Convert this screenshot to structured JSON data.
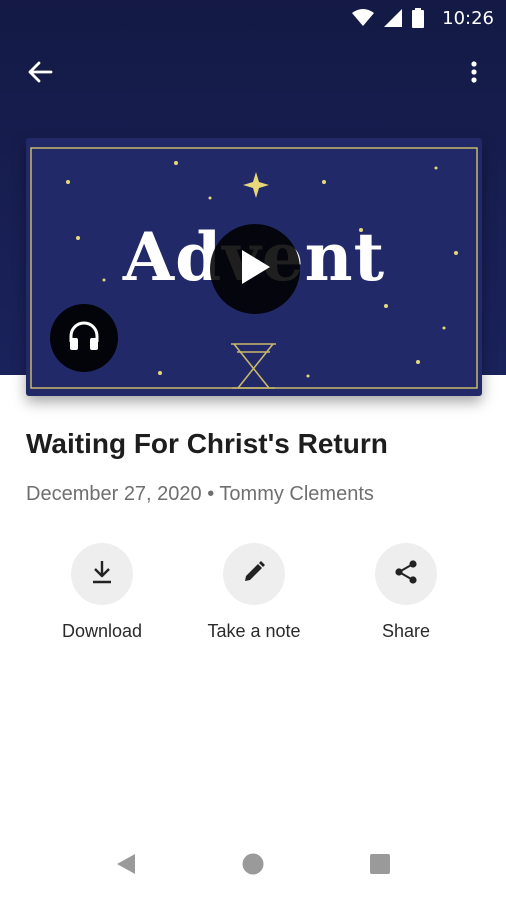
{
  "status_bar": {
    "time": "10:26"
  },
  "icons": {
    "back": "arrow-left-icon",
    "more": "more-vertical-icon",
    "play": "play-icon",
    "audio": "headphones-icon",
    "download": "download-icon",
    "note": "pencil-icon",
    "share": "share-icon"
  },
  "media": {
    "artwork_text": "Advent"
  },
  "sermon": {
    "title": "Waiting For Christ's Return",
    "meta": "December 27, 2020 • Tommy Clements"
  },
  "actions": [
    {
      "label": "Download"
    },
    {
      "label": "Take a note"
    },
    {
      "label": "Share"
    }
  ],
  "colors": {
    "header_bg": "#1a225c",
    "artwork_bg": "#212969",
    "star": "#e8d87a",
    "action_circle": "#eeeeee"
  }
}
